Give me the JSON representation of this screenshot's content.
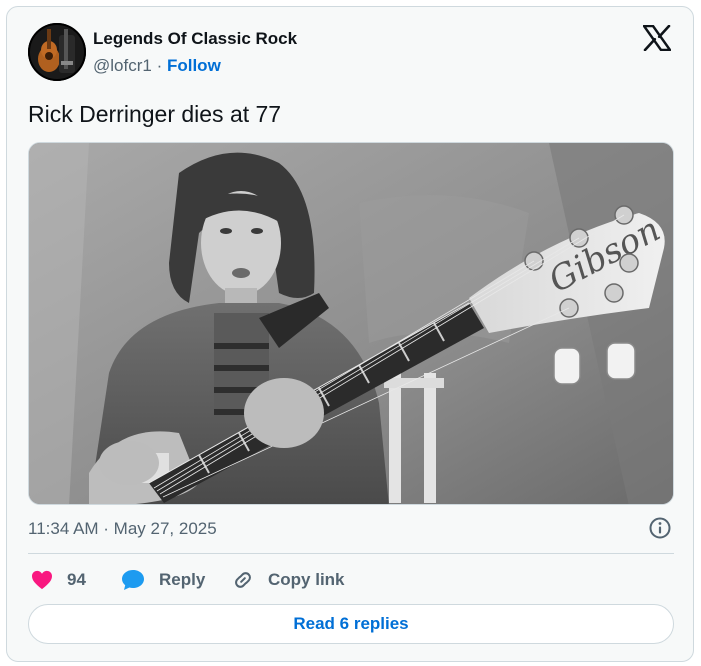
{
  "author": {
    "name": "Legends Of Classic Rock",
    "handle": "@lofcr1",
    "separator": "·",
    "follow_label": "Follow"
  },
  "tweet": {
    "text": "Rick Derringer dies at 77",
    "timestamp": "11:34 AM · May 27, 2025"
  },
  "media": {
    "description_icon": "photo",
    "brand_on_headstock": "Gibson"
  },
  "actions": {
    "likes_count": "94",
    "reply_label": "Reply",
    "copy_link_label": "Copy link"
  },
  "footer": {
    "read_replies_label": "Read 6 replies"
  },
  "colors": {
    "like": "#f91880",
    "reply": "#1d9bf0",
    "link": "#006fd6",
    "muted": "#536471",
    "border": "#cfd9de"
  },
  "icons": [
    "x-logo-icon",
    "info-icon",
    "heart-icon",
    "reply-bubble-icon",
    "link-icon"
  ]
}
